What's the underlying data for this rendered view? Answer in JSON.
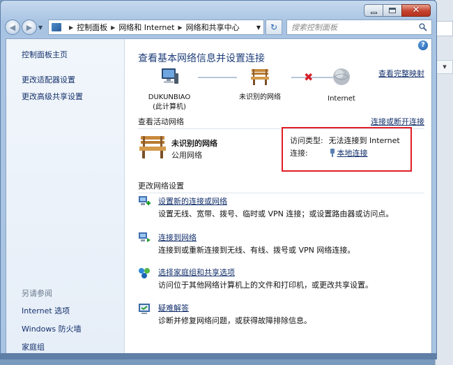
{
  "window": {
    "address_crumbs": [
      "控制面板",
      "网络和 Internet",
      "网络和共享中心"
    ],
    "search_placeholder": "搜索控制面板",
    "minimize_glyph": "",
    "close_glyph": "✕"
  },
  "sidebar": {
    "top_link": "控制面板主页",
    "links": [
      "更改适配器设置",
      "更改高级共享设置"
    ],
    "see_also_label": "另请参阅",
    "see_also_links": [
      "Internet 选项",
      "Windows 防火墙",
      "家庭组"
    ]
  },
  "main": {
    "help_glyph": "?",
    "title": "查看基本网络信息并设置连接",
    "view_full_map": "查看完整映射",
    "map": {
      "computer_name": "DUKUNBIAO",
      "computer_sub": "(此计算机)",
      "network_name": "未识别的网络",
      "internet_name": "Internet"
    },
    "active_section_label": "查看活动网络",
    "connect_disconnect": "连接或断开连接",
    "active_network": {
      "name": "未识别的网络",
      "kind": "公用网络",
      "access_type_label": "访问类型:",
      "access_type_value": "无法连接到 Internet",
      "connection_label": "连接:",
      "connection_value": "本地连接"
    },
    "change_section_label": "更改网络设置",
    "tasks": [
      {
        "link": "设置新的连接或网络",
        "desc": "设置无线、宽带、拨号、临时或 VPN 连接；或设置路由器或访问点。",
        "icon": "new-connection-icon"
      },
      {
        "link": "连接到网络",
        "desc": "连接到或重新连接到无线、有线、拨号或 VPN 网络连接。",
        "icon": "connect-network-icon"
      },
      {
        "link": "选择家庭组和共享选项",
        "desc": "访问位于其他网络计算机上的文件和打印机，或更改共享设置。",
        "icon": "homegroup-icon"
      },
      {
        "link": "疑难解答",
        "desc": "诊断并修复网络问题，或获得故障排除信息。",
        "icon": "troubleshoot-icon"
      }
    ]
  },
  "colors": {
    "link": "#14316c",
    "title": "#1f3e7a",
    "highlight": "#e01d24",
    "x_mark": "#d6202a"
  }
}
